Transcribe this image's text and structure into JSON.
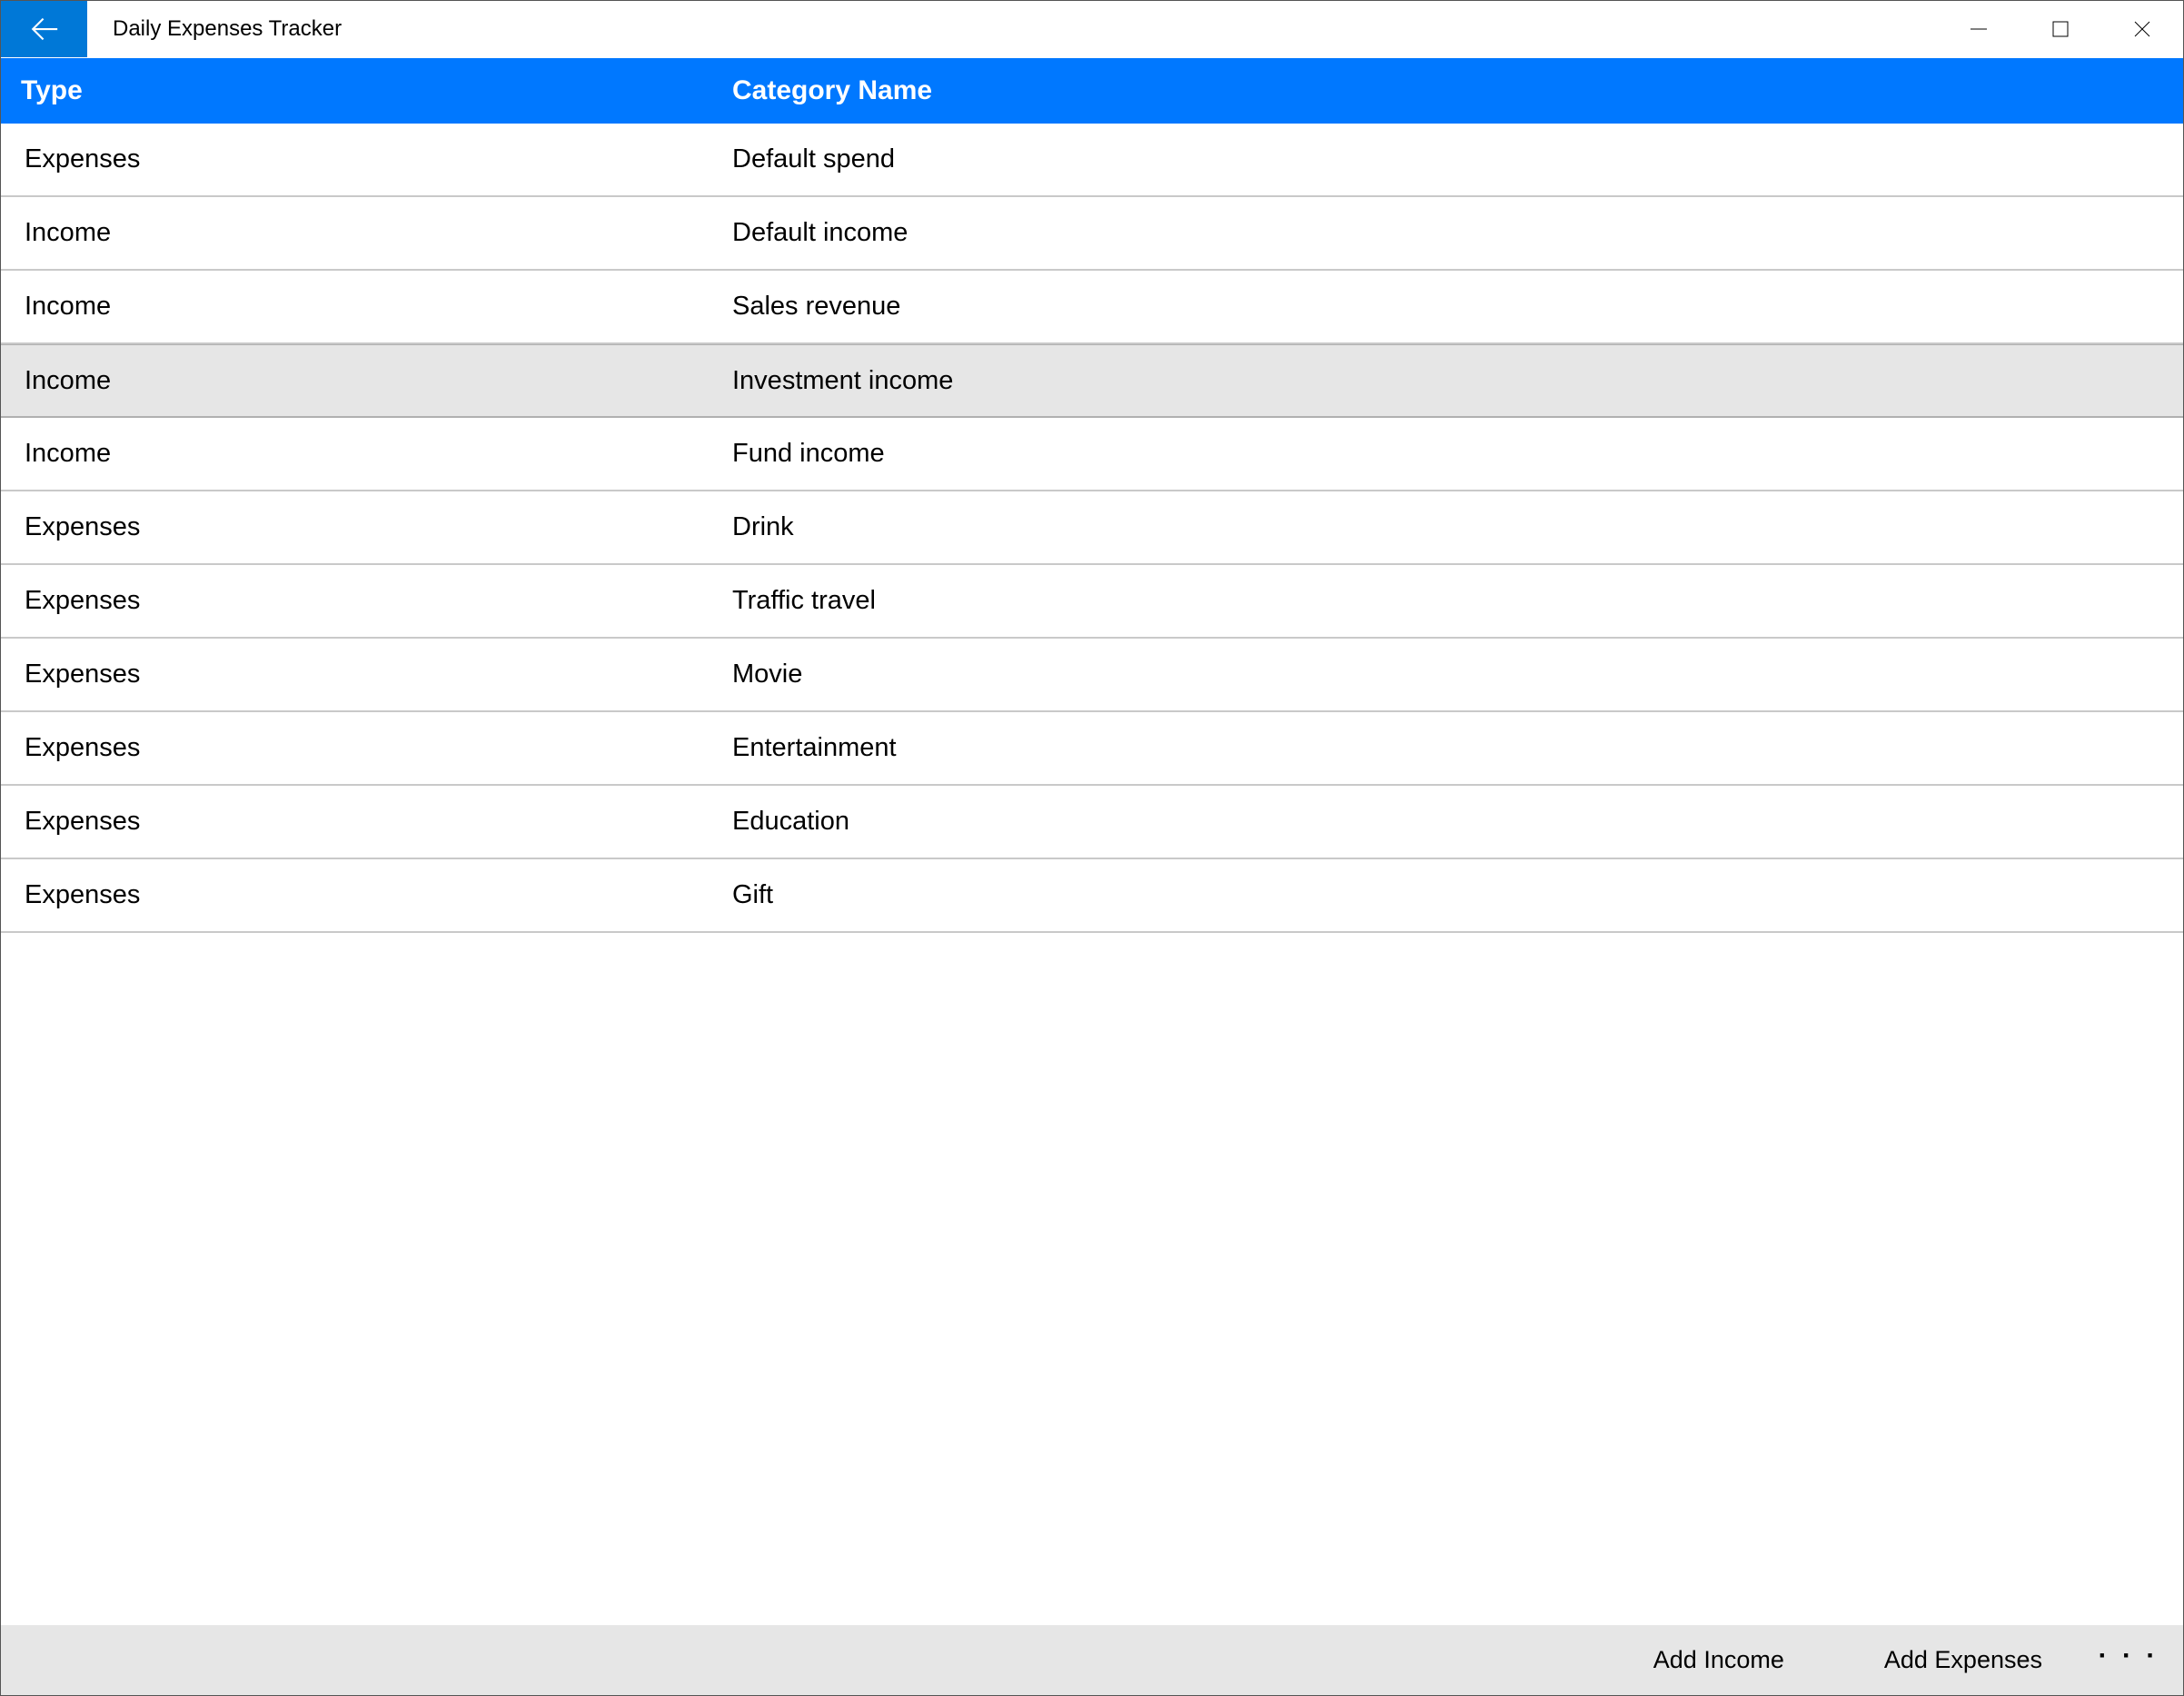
{
  "titlebar": {
    "title": "Daily Expenses Tracker"
  },
  "header": {
    "type_label": "Type",
    "name_label": "Category Name"
  },
  "rows": [
    {
      "type": "Expenses",
      "name": "Default spend",
      "highlighted": false
    },
    {
      "type": "Income",
      "name": "Default income",
      "highlighted": false
    },
    {
      "type": "Income",
      "name": "Sales revenue",
      "highlighted": false
    },
    {
      "type": "Income",
      "name": "Investment income",
      "highlighted": true
    },
    {
      "type": "Income",
      "name": "Fund income",
      "highlighted": false
    },
    {
      "type": "Expenses",
      "name": "Drink",
      "highlighted": false
    },
    {
      "type": "Expenses",
      "name": "Traffic travel",
      "highlighted": false
    },
    {
      "type": "Expenses",
      "name": "Movie",
      "highlighted": false
    },
    {
      "type": "Expenses",
      "name": "Entertainment",
      "highlighted": false
    },
    {
      "type": "Expenses",
      "name": "Education",
      "highlighted": false
    },
    {
      "type": "Expenses",
      "name": "Gift",
      "highlighted": false
    }
  ],
  "bottombar": {
    "add_income": "Add Income",
    "add_expenses": "Add Expenses"
  }
}
